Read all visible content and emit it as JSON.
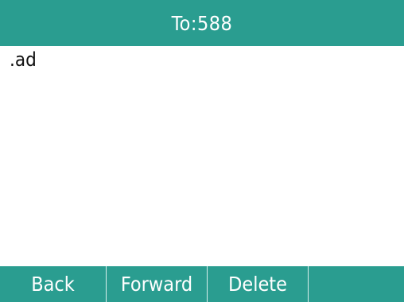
{
  "header": {
    "title": "To:588"
  },
  "message": {
    "text": ".ad"
  },
  "softkeys": [
    {
      "label": "Back"
    },
    {
      "label": "Forward"
    },
    {
      "label": "Delete"
    },
    {
      "label": ""
    }
  ],
  "colors": {
    "bar_background": "#2a9d90",
    "bar_text": "#ffffff",
    "body_background": "#ffffff",
    "body_text": "#111111"
  }
}
